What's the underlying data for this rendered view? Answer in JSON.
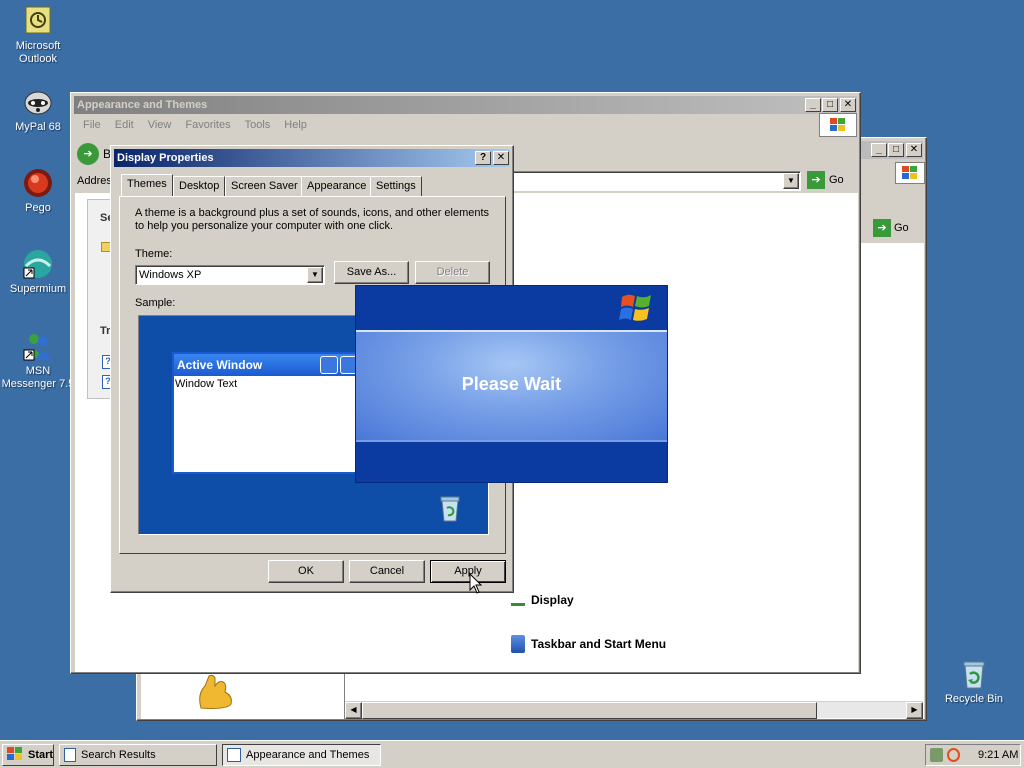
{
  "desktop": {
    "icons": [
      {
        "label": "Microsoft Outlook",
        "icon": "outlook-icon"
      },
      {
        "label": "MyPal 68",
        "icon": "raccoon-icon"
      },
      {
        "label": "Pego",
        "icon": "pego-icon"
      },
      {
        "label": "Supermium",
        "icon": "supermium-icon"
      },
      {
        "label": "MSN Messenger 7.5",
        "icon": "msn-icon"
      },
      {
        "label": "Recycle Bin",
        "icon": "recycle-bin-icon"
      }
    ]
  },
  "explorer": {
    "title": "Appearance and Themes",
    "menu": [
      "File",
      "Edit",
      "View",
      "Favorites",
      "Tools",
      "Help"
    ],
    "address_label": "Address",
    "go_label": "Go",
    "back_label": "B",
    "side_headings": [
      "Se",
      "Tr"
    ],
    "tasks": [
      "Display",
      "Taskbar and Start Menu"
    ]
  },
  "back_window": {
    "go_label": "Go"
  },
  "display_properties": {
    "title": "Display Properties",
    "tabs": [
      "Themes",
      "Desktop",
      "Screen Saver",
      "Appearance",
      "Settings"
    ],
    "description": "A theme is a background plus a set of sounds, icons, and other elements to help you personalize your computer with one click.",
    "theme_label": "Theme:",
    "theme_value": "Windows XP",
    "save_as": "Save As...",
    "delete": "Delete",
    "sample_label": "Sample:",
    "sample_window_title": "Active Window",
    "sample_window_text": "Window Text",
    "ok": "OK",
    "cancel": "Cancel",
    "apply": "Apply"
  },
  "please_wait": {
    "message": "Please Wait"
  },
  "taskbar": {
    "start": "Start",
    "items": [
      "Search Results",
      "Appearance and Themes"
    ],
    "clock": "9:21 AM"
  },
  "colors": {
    "desktop": "#3a6ea5",
    "title_active": "#0a246a",
    "xp_blue": "#0c3fa7"
  }
}
